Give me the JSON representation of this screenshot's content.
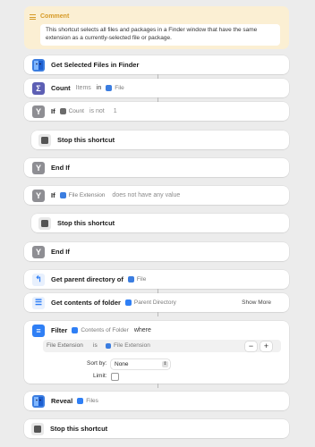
{
  "comment": {
    "title": "Comment",
    "text": "This shortcut selects all files and packages in a Finder window that have the same extension as a currently-selected file or package."
  },
  "actions": {
    "get_selected": {
      "title": "Get Selected Files in Finder"
    },
    "count": {
      "title": "Count",
      "p1": "Items",
      "in": "in",
      "token": "File"
    },
    "if1": {
      "title": "If",
      "token": "Count",
      "p1": "is not",
      "value": "1"
    },
    "stop1": {
      "title": "Stop this shortcut"
    },
    "endif1": {
      "title": "End If"
    },
    "if2": {
      "title": "If",
      "token": "File Extension",
      "p1": "does not have any value"
    },
    "stop2": {
      "title": "Stop this shortcut"
    },
    "endif2": {
      "title": "End If"
    },
    "get_parent": {
      "title": "Get parent directory of",
      "token": "File"
    },
    "get_contents": {
      "title": "Get contents of folder",
      "token": "Parent Directory",
      "show_more": "Show More"
    },
    "filter": {
      "title": "Filter",
      "token": "Contents of Folder",
      "where": "where",
      "rule_field": "File Extension",
      "rule_op": "is",
      "rule_token": "File Extension",
      "minus": "−",
      "plus": "+",
      "sort_label": "Sort by:",
      "sort_value": "None",
      "limit_label": "Limit:"
    },
    "reveal": {
      "title": "Reveal",
      "token": "Files"
    },
    "stop3": {
      "title": "Stop this shortcut"
    }
  },
  "colors": {
    "finder": "#3b7de0",
    "count": "#5d5fb4",
    "if": "#8e8e93",
    "files_blue": "#2f7ff5",
    "comment_bg": "#fbefd3",
    "comment_accent": "#d69a27"
  }
}
